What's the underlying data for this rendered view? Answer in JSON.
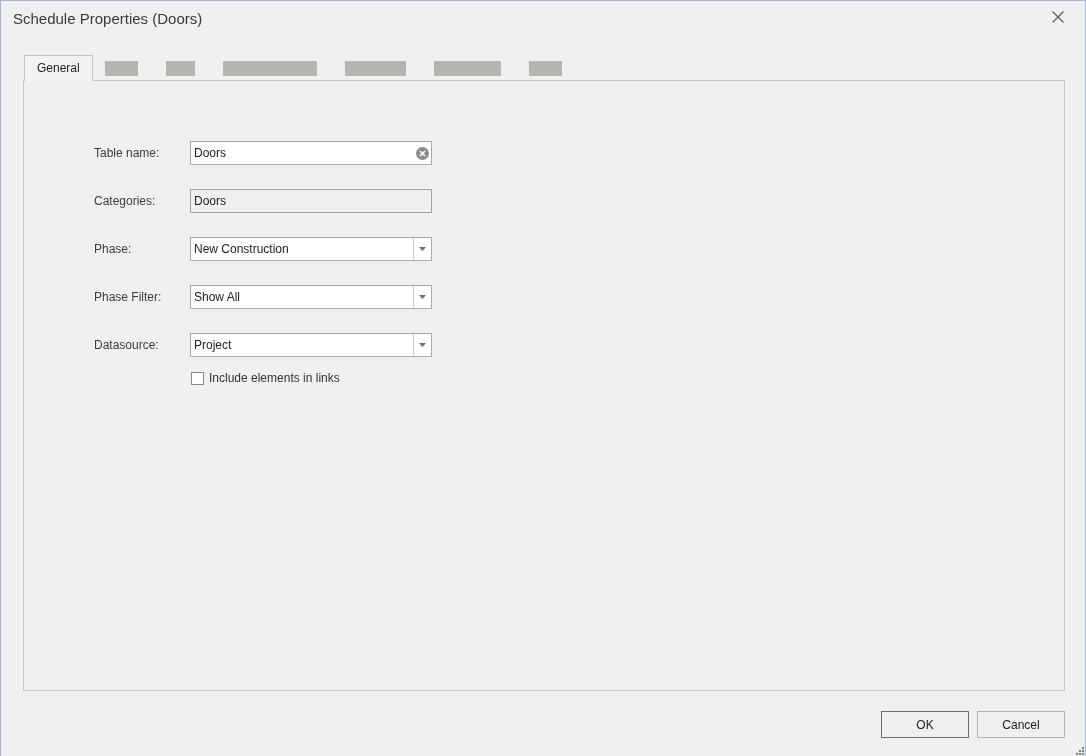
{
  "window": {
    "title": "Schedule Properties (Doors)"
  },
  "tabs": [
    {
      "kind": "text",
      "label": "General",
      "selected": true
    },
    {
      "kind": "redacted",
      "selected": false
    },
    {
      "kind": "redacted",
      "selected": false
    },
    {
      "kind": "redacted",
      "selected": false
    },
    {
      "kind": "redacted",
      "selected": false
    },
    {
      "kind": "redacted",
      "selected": false
    },
    {
      "kind": "redacted",
      "selected": false
    }
  ],
  "form": {
    "fields": [
      {
        "label": "Table name:",
        "kind": "text",
        "value": "Doors",
        "disabled": false,
        "clear_button": true
      },
      {
        "label": "Categories:",
        "kind": "text",
        "value": "Doors",
        "disabled": true,
        "clear_button": false
      },
      {
        "label": "Phase:",
        "kind": "dropdown",
        "value": "New Construction",
        "disabled": false,
        "clear_button": false
      },
      {
        "label": "Phase Filter:",
        "kind": "dropdown",
        "value": "Show All",
        "disabled": false,
        "clear_button": false
      },
      {
        "label": "Datasource:",
        "kind": "dropdown",
        "value": "Project",
        "disabled": false,
        "clear_button": false
      }
    ],
    "include_links": {
      "label": "Include elements in links",
      "checked": false
    }
  },
  "buttons": [
    {
      "label": "OK",
      "default": true
    },
    {
      "label": "Cancel",
      "default": false
    }
  ]
}
